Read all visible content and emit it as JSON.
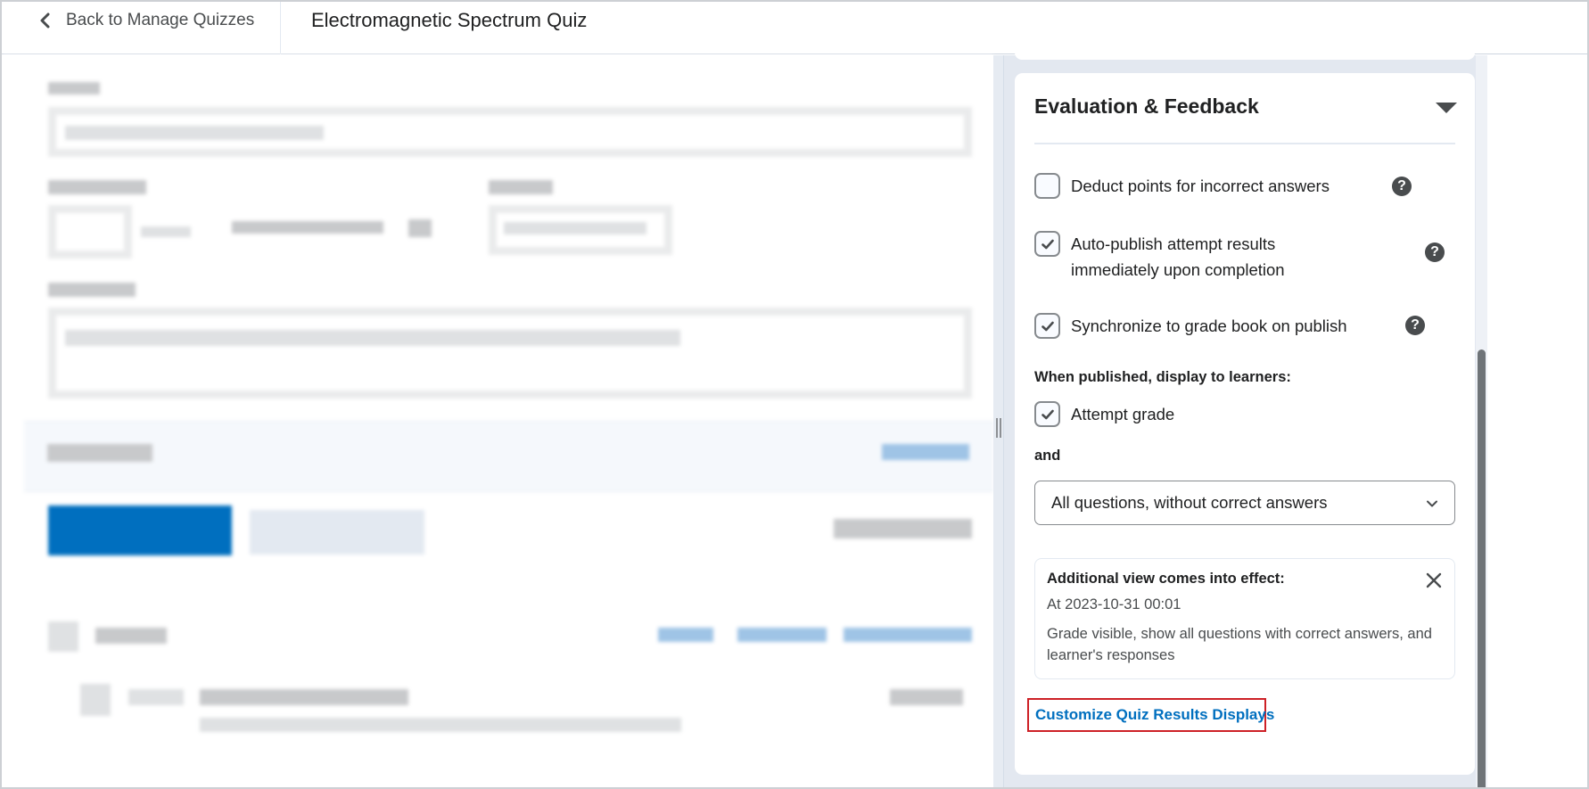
{
  "header": {
    "back_label": "Back to Manage Quizzes",
    "back_icon": "chevron-left-icon",
    "title": "Electromagnetic Spectrum Quiz"
  },
  "left_pane": {
    "note": "content obscured (blurred)"
  },
  "panel": {
    "title": "Evaluation & Feedback",
    "collapse_icon": "caret-down-icon",
    "options": [
      {
        "label": "Deduct points for incorrect answers",
        "checked": false,
        "help_icon": "help-icon"
      },
      {
        "label_line1": "Auto-publish attempt results",
        "label_line2": "immediately upon completion",
        "checked": true,
        "help_icon": "help-icon"
      },
      {
        "label": "Synchronize to grade book on publish",
        "checked": true,
        "help_icon": "help-icon"
      }
    ],
    "display_label": "When published, display to learners:",
    "attempt_grade": {
      "label": "Attempt grade",
      "checked": true
    },
    "and_label": "and",
    "select": {
      "value": "All questions, without correct answers"
    },
    "additional_view": {
      "title": "Additional view comes into effect:",
      "date": "At 2023-10-31 00:01",
      "description": "Grade visible, show all questions with correct answers, and learner's responses",
      "close_icon": "close-icon"
    },
    "customize_link": "Customize Quiz Results Displays",
    "help_glyph": "?"
  },
  "colors": {
    "link_blue": "#006fbf",
    "highlight_red": "#cd2026",
    "text_dark": "#202122",
    "text_muted": "#494c4e",
    "panel_bg": "#e3e8f0",
    "scroll_thumb": "#6f7478"
  }
}
